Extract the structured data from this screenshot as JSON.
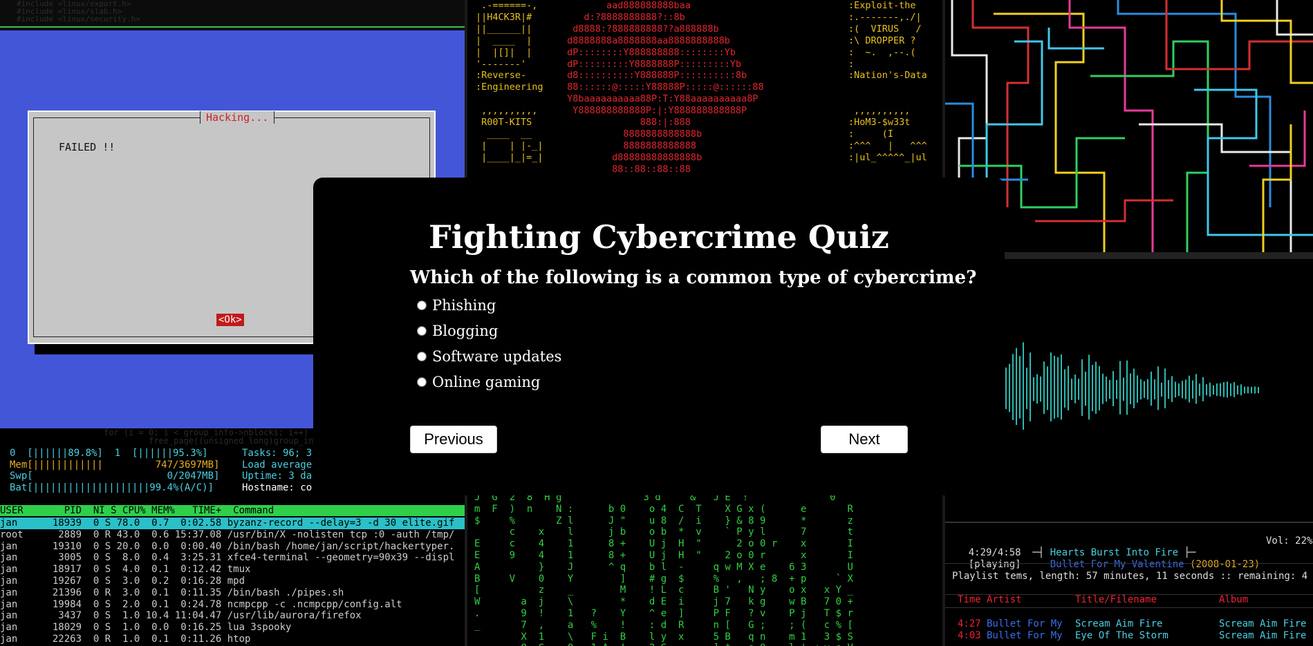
{
  "quiz": {
    "title": "Fighting Cybercrime Quiz",
    "question": "Which of the following is a common type of cybercrime?",
    "options": [
      "Phishing",
      "Blogging",
      "Software updates",
      "Online gaming"
    ],
    "prev_label": "Previous",
    "next_label": "Next"
  },
  "dialog": {
    "title": "Hacking...",
    "message": "FAILED !!",
    "ok_label": "<Ok>"
  },
  "htop": {
    "cpu0": "0  [||||||89.8%]",
    "cpu1": "1  [||||||95.3%]",
    "mem": "Mem[||||||||||||         747/3697MB]",
    "swp": "Swp[                       0/2047MB]",
    "bat": "Bat[||||||||||||||||||||99.4%(A/C)]",
    "tasks": "Tasks: 96; 3",
    "load": "Load average",
    "uptime": "Uptime: 3 da",
    "hostname": "Hostname: co",
    "header": "USER       PID  NI S CPU% MEM%   TIME+  Command",
    "rows": [
      "jan      18939  0 S 78.0  0.7  0:02.58 byzanz-record --delay=3 -d 30 elite.gif",
      "root      2889  0 R 43.0  0.6 15:37.08 /usr/bin/X -nolisten tcp :0 -auth /tmp/",
      "jan      19310  0 S 20.0  0.0  0:00.40 /bin/bash /home/jan/script/hackertyper.",
      "jan       3005  0 S  8.0  0.4  3:25.31 xfce4-terminal --geometry=90x39 --displ",
      "jan      18917  0 S  4.0  0.1  0:12.42 tmux",
      "jan      19267  0 S  3.0  0.2  0:16.28 mpd",
      "jan      21396  0 R  3.0  0.1  0:11.35 /bin/bash ./pipes.sh",
      "jan      19984  0 S  2.0  0.1  0:24.78 ncmpcpp -c .ncmpcpp/config.alt",
      "jan       3437  0 S  1.0 10.4 11:04.47 /usr/lib/aurora/firefox",
      "jan      18029  0 S  1.0  0.0  0:16.25 lua 3spooky",
      "jan      22263  0 R  1.0  0.1  0:11.26 htop"
    ]
  },
  "ascii": {
    "left": " .-======-,\n||H4CK3R|#\n||______||\n|  ____  |\n|  |[]|  |\n'-------'\n:Reverse-\n:Engineering\n\n ,,,,,,,,,,\n R00T-KITS\n  ____  __\n |    | |-_|\n |____|_|=_|",
    "center": "        aad888888888baa\n    d:?8888888888?::8b\n  d8888:?888888888??a888888b\n d8888888a8888888aa8888888888b\n dP::::::::Y888888888::::::::Yb\n dP:::::::::Y8888888P:::::::::Yb\n d8::::::::::Y888888P::::::::::8b\n 88::::::@:::::Y88888P:::::@::::::88\n Y8baaaaaaaaaa88P:T:Y88aaaaaaaaaa8P\n  Y888888888888P:|:Y888888888888P\n              888:|:888\n           8888888888888b\n           8888888888888\n         d88888888888888b\n         88::88::88::88",
    "right": ":Exploit-the\n:.-------,./|\n:(  VIRUS   /\n:\\ DROPPER ?\n:  ~.  ,--.(\n:\n:Nation's-Data\n\n\n ,,,,,,,,,,\n:HoM3-$w33t\n:     (I\n:^^^   |   ^^^\n:|ul_^^^^^_|ul"
  },
  "ncmpcpp": {
    "time": "4:29/4:58",
    "title": "Hearts Burst Into Fire",
    "status": "[playing]",
    "artist_album": "Bullet For My Valentine",
    "date": "(2008-01-23)",
    "vol": "Vol: 22%",
    "playlist": "Playlist tems, length: 57 minutes, 11 seconds :: remaining: 4",
    "col_time": "Time",
    "col_artist": "Artist",
    "col_title": "Title/Filename",
    "col_album": "Album",
    "rows": [
      {
        "time": "4:27",
        "artist": "Bullet For My",
        "title": "Scream Aim Fire",
        "album": "Scream Aim Fire"
      },
      {
        "time": "4:03",
        "artist": "Bullet For My",
        "title": "Eye Of The Storm",
        "album": "Scream Aim Fire"
      }
    ]
  },
  "colors": {
    "dialog_bg": "#4456d8",
    "htop_green": "#2ed04a",
    "matrix_green": "#30d040",
    "ok_red": "#c21a1a"
  }
}
